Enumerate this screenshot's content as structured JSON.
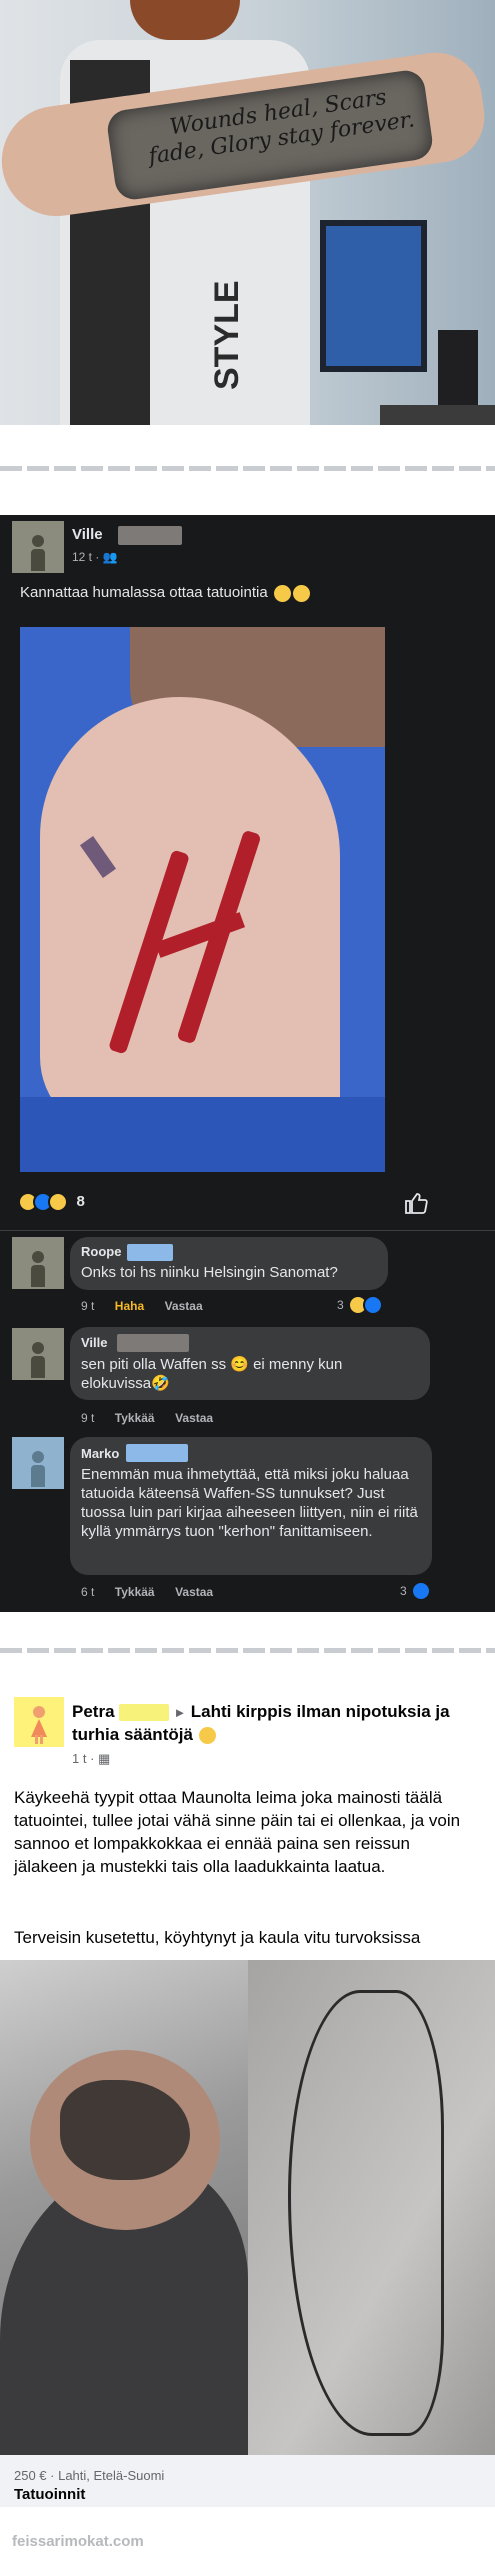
{
  "top_photo": {
    "tattoo_text": "Wounds heal, Scars fade, Glory stay forever.",
    "shirt_print": "STYLE"
  },
  "fb_post": {
    "author": "Ville",
    "time": "12 t",
    "text": "Kannattaa humalassa ottaa tatuointia",
    "reaction_count": "8",
    "comments": [
      {
        "name": "Roope",
        "text": "Onks toi hs niinku Helsingin Sanomat?",
        "time": "9 t",
        "like_label": "Haha",
        "reply_label": "Vastaa",
        "reaction_count": "3"
      },
      {
        "name": "Ville",
        "text": "sen piti olla Waffen ss 😊 ei menny kun elokuvissa🤣",
        "time": "9 t",
        "like_label": "Tykkää",
        "reply_label": "Vastaa"
      },
      {
        "name": "Marko",
        "text": "Enemmän mua ihmetyttää, että miksi joku haluaa tatuoida käteensä Waffen-SS tunnukset? Just tuossa luin pari kirjaa aiheeseen liittyen, niin ei riitä kyllä ymmärrys tuon \"kerhon\" fanittamiseen.",
        "time": "6 t",
        "like_label": "Tykkää",
        "reply_label": "Vastaa",
        "reaction_count": "3"
      }
    ]
  },
  "mp_post": {
    "author": "Petra",
    "group": "Lahti kirppis ilman nipotuksia ja turhia sääntöjä",
    "time": "1 t",
    "text1": "Käykeehä tyypit ottaa Maunolta leima joka mainosti täälä tatuointei, tullee jotai vähä sinne päin tai ei ollenkaa, ja voin sannoo et lompakkokkaa ei ennää paina sen reissun jälakeen ja mustekki tais olla laadukkainta laatua.",
    "text2": "Terveisin kusetettu, köyhtynyt ja kaula vitu turvoksissa",
    "price_location": "250 € · Lahti, Etelä-Suomi",
    "category": "Tatuoinnit"
  },
  "watermark": "feissarimokat.com",
  "colors": {
    "dark_bg": "#18191a",
    "bubble": "#3a3b3c",
    "haha": "#f7b928",
    "fb_blue": "#1877f2"
  }
}
